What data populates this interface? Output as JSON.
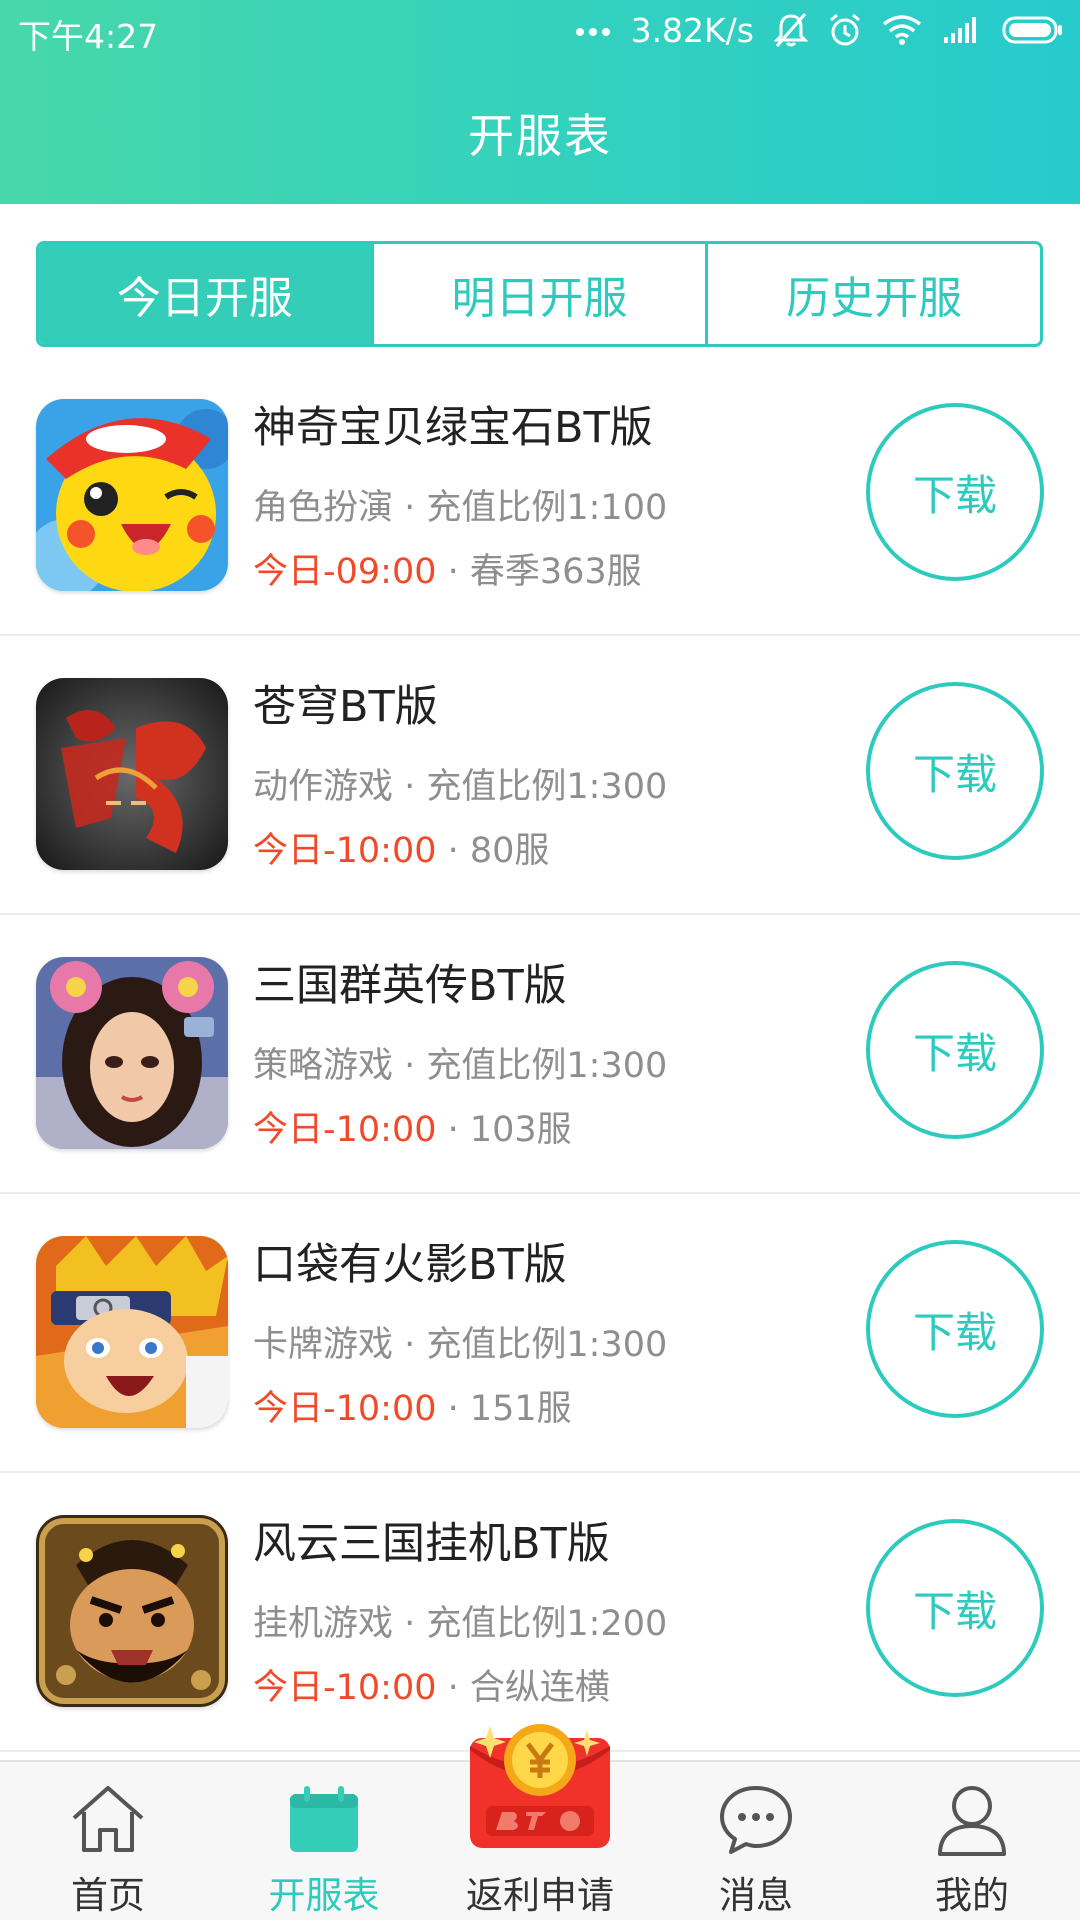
{
  "status_bar": {
    "time": "下午4:27",
    "speed": "3.82K/s",
    "icons": [
      "dots-icon",
      "mute-icon",
      "alarm-icon",
      "wifi-icon",
      "signal-icon",
      "battery-icon"
    ]
  },
  "header": {
    "title": "开服表"
  },
  "tabs": [
    {
      "label": "今日开服",
      "active": true
    },
    {
      "label": "明日开服",
      "active": false
    },
    {
      "label": "历史开服",
      "active": false
    }
  ],
  "games": [
    {
      "name": "神奇宝贝绿宝石BT版",
      "meta": "角色扮演 · 充值比例1:100",
      "time": "今日-09:00",
      "server": " · 春季363服",
      "button": "下载",
      "icon": "pikachu-icon"
    },
    {
      "name": "苍穹BT版",
      "meta": "动作游戏 · 充值比例1:300",
      "time": "今日-10:00",
      "server": " · 80服",
      "button": "下载",
      "icon": "cangqiong-icon"
    },
    {
      "name": "三国群英传BT版",
      "meta": "策略游戏 · 充值比例1:300",
      "time": "今日-10:00",
      "server": " · 103服",
      "button": "下载",
      "icon": "sanguo-girl-icon"
    },
    {
      "name": "口袋有火影BT版",
      "meta": "卡牌游戏 · 充值比例1:300",
      "time": "今日-10:00",
      "server": " · 151服",
      "button": "下载",
      "icon": "naruto-icon"
    },
    {
      "name": "风云三国挂机BT版",
      "meta": "挂机游戏 · 充值比例1:200",
      "time": "今日-10:00",
      "server": " · 合纵连横",
      "button": "下载",
      "icon": "zhangfei-icon"
    }
  ],
  "bottom_nav": [
    {
      "label": "首页",
      "icon": "home-icon",
      "active": false
    },
    {
      "label": "开服表",
      "icon": "calendar-icon",
      "active": true
    },
    {
      "label": "返利申请",
      "icon": "red-envelope-icon",
      "active": false
    },
    {
      "label": "消息",
      "icon": "chat-icon",
      "active": false
    },
    {
      "label": "我的",
      "icon": "user-icon",
      "active": false
    }
  ],
  "colors": {
    "accent": "#2ccbbd",
    "header_start": "#47d8aa",
    "header_end": "#27cbcc",
    "time_red": "#f04a2a",
    "meta_gray": "#8e8e8e"
  }
}
